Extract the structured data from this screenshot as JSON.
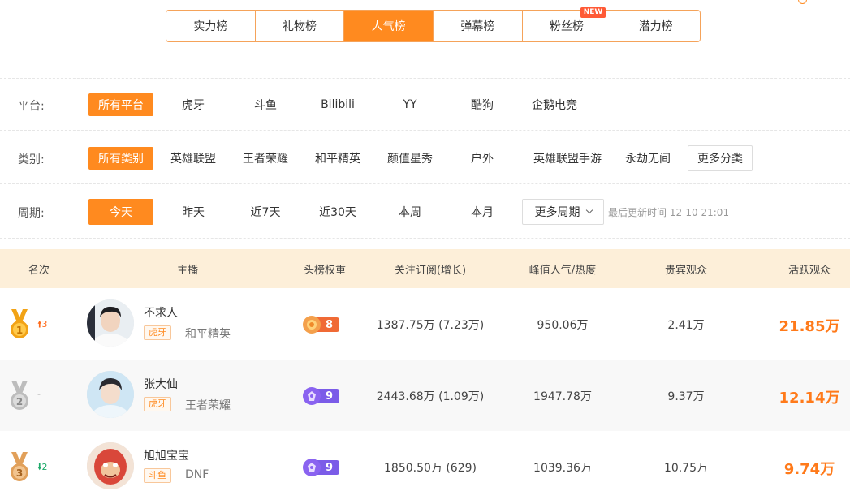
{
  "tabs": [
    {
      "label": "实力榜",
      "active": false
    },
    {
      "label": "礼物榜",
      "active": false
    },
    {
      "label": "人气榜",
      "active": true
    },
    {
      "label": "弹幕榜",
      "active": false
    },
    {
      "label": "粉丝榜",
      "active": false,
      "badge": "NEW"
    },
    {
      "label": "潜力榜",
      "active": false
    }
  ],
  "filters": {
    "platform": {
      "label": "平台:",
      "options": [
        "所有平台",
        "虎牙",
        "斗鱼",
        "Bilibili",
        "YY",
        "酷狗",
        "企鹅电竞"
      ],
      "selected": "所有平台"
    },
    "category": {
      "label": "类别:",
      "options": [
        "所有类别",
        "英雄联盟",
        "王者荣耀",
        "和平精英",
        "颜值星秀",
        "户外",
        "英雄联盟手游",
        "永劫无间"
      ],
      "more": "更多分类",
      "selected": "所有类别"
    },
    "period": {
      "label": "周期:",
      "options": [
        "今天",
        "昨天",
        "近7天",
        "近30天",
        "本周",
        "本月"
      ],
      "more": "更多周期",
      "selected": "今天",
      "updated": "最后更新时间 12-10 21:01"
    }
  },
  "table": {
    "headers": [
      "名次",
      "主播",
      "头榜权重",
      "关注订阅(增长)",
      "峰值人气/热度",
      "贵宾观众",
      "活跃观众"
    ],
    "rows": [
      {
        "rank": "1",
        "trend": "3",
        "trend_dir": "up",
        "name": "不求人",
        "platform": "虎牙",
        "category": "和平精英",
        "weight": "8",
        "weight_color": "#f06a35",
        "follow": "1387.75万 (7.23万)",
        "peak": "950.06万",
        "vip": "2.41万",
        "active": "21.85万",
        "medal_color": "#f2a316"
      },
      {
        "rank": "2",
        "trend": "-",
        "trend_dir": "flat",
        "name": "张大仙",
        "platform": "虎牙",
        "category": "王者荣耀",
        "weight": "9",
        "weight_color": "#7b5ce8",
        "follow": "2443.68万 (1.09万)",
        "peak": "1947.78万",
        "vip": "9.37万",
        "active": "12.14万",
        "medal_color": "#b7b7b7"
      },
      {
        "rank": "3",
        "trend": "2",
        "trend_dir": "down",
        "name": "旭旭宝宝",
        "platform": "斗鱼",
        "category": "DNF",
        "weight": "9",
        "weight_color": "#7b5ce8",
        "follow": "1850.50万 (629)",
        "peak": "1039.36万",
        "vip": "10.75万",
        "active": "9.74万",
        "medal_color": "#e1a05a"
      }
    ]
  }
}
